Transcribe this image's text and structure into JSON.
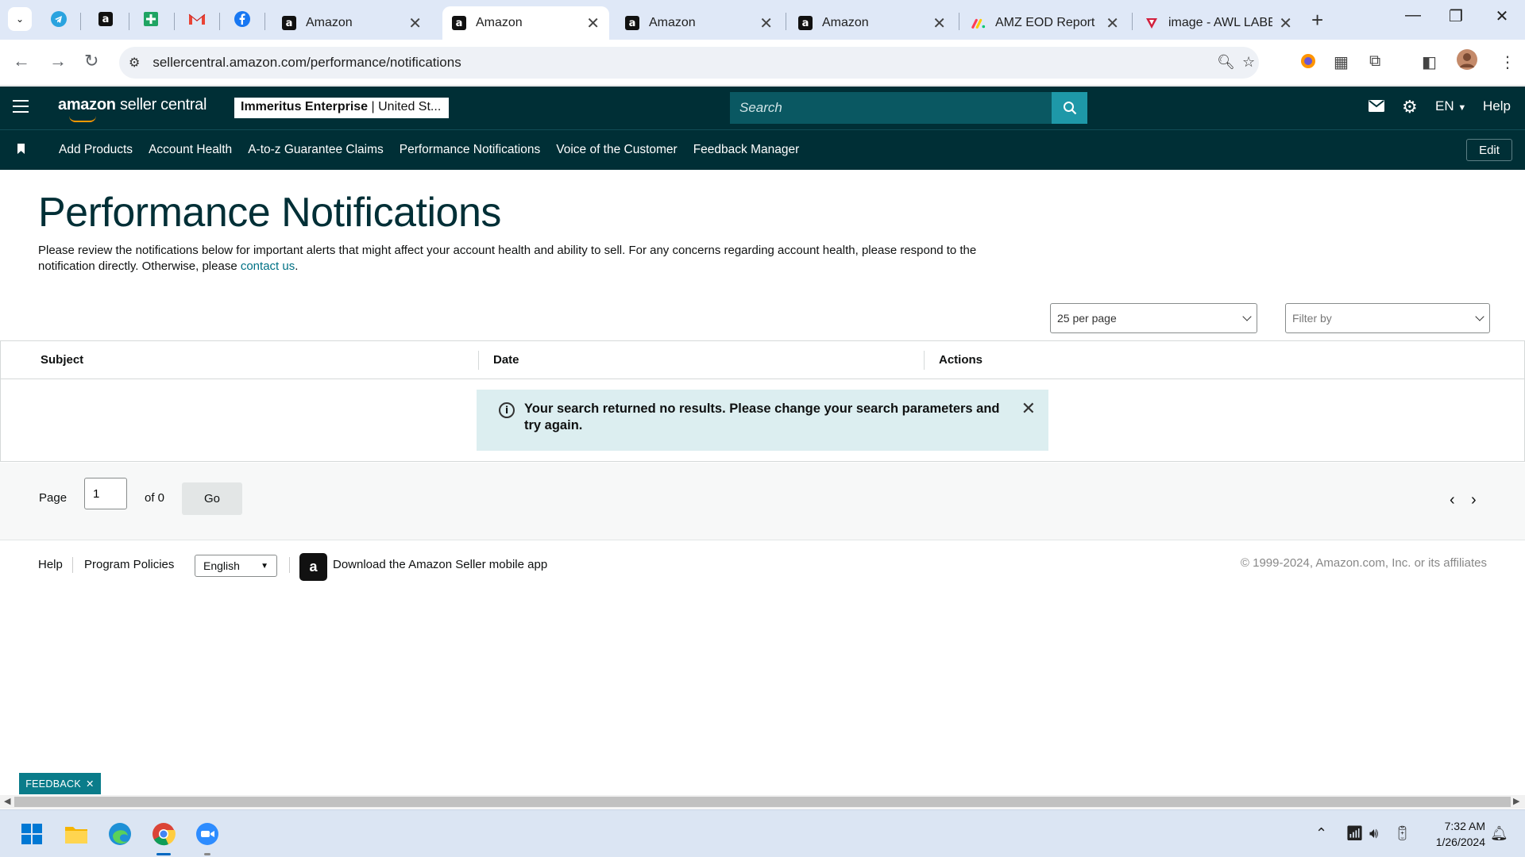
{
  "browser": {
    "tabs": [
      {
        "title": "Amazon",
        "favicon": "amazon-a"
      },
      {
        "title": "Amazon",
        "favicon": "amazon-a",
        "active": true
      },
      {
        "title": "Amazon",
        "favicon": "amazon-a"
      },
      {
        "title": "Amazon",
        "favicon": "amazon-a"
      },
      {
        "title": "AMZ EOD Report",
        "favicon": "monday-logo"
      },
      {
        "title": "image - AWL LABEL",
        "favicon": "vivaldi-like-logo"
      }
    ],
    "pinned_tabs": [
      "telegram-icon",
      "amazon-icon",
      "sheets-icon",
      "gmail-icon",
      "facebook-icon"
    ],
    "url": "sellercentral.amazon.com/performance/notifications"
  },
  "seller": {
    "logo_brand": "amazon",
    "logo_suffix": "seller central",
    "account_name": "Immeritus Enterprise",
    "account_region": "United St...",
    "search_placeholder": "Search",
    "language": "EN",
    "help_label": "Help",
    "nav_links": [
      "Add Products",
      "Account Health",
      "A-to-z Guarantee Claims",
      "Performance Notifications",
      "Voice of the Customer",
      "Feedback Manager"
    ],
    "edit_label": "Edit"
  },
  "page": {
    "title": "Performance Notifications",
    "description": "Please review the notifications below for important alerts that might affect your account health and ability to sell. For any concerns regarding account health, please respond to the notification directly. Otherwise, please ",
    "contact_link": "contact us",
    "description_end": ".",
    "per_page": "25 per page",
    "filter_placeholder": "Filter by",
    "columns": [
      "Subject",
      "Date",
      "Actions"
    ],
    "alert_message": "Your search returned no results. Please change your search parameters and try again.",
    "pager": {
      "page_label": "Page",
      "page_value": "1",
      "of_label": "of 0",
      "go_label": "Go"
    }
  },
  "footer": {
    "help": "Help",
    "program_policies": "Program Policies",
    "language": "English",
    "app_download": "Download the Amazon Seller mobile app",
    "copyright": "© 1999-2024, Amazon.com, Inc. or its affiliates"
  },
  "feedback_label": "FEEDBACK",
  "taskbar": {
    "time": "7:32 AM",
    "date": "1/26/2024",
    "apps": [
      "windows-start-icon",
      "file-explorer-icon",
      "edge-icon",
      "chrome-icon",
      "zoom-icon"
    ]
  },
  "colors": {
    "header": "#002f36",
    "accent": "#007185",
    "alert_bg": "#dceef0",
    "search_btn": "#1e98a8"
  }
}
